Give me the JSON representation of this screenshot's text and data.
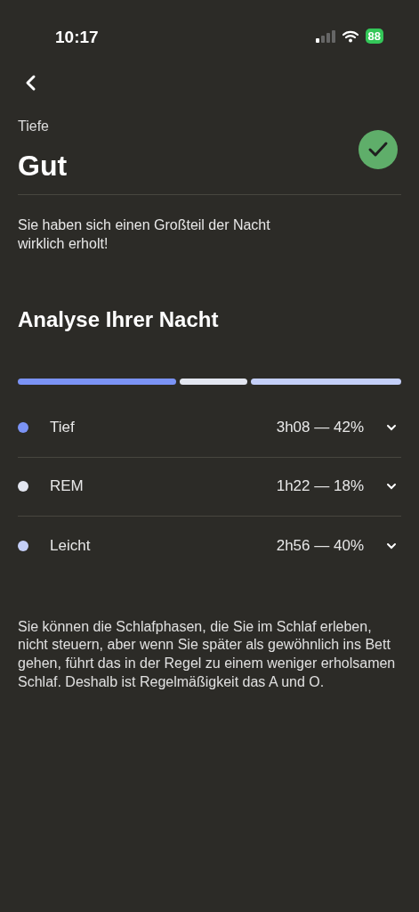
{
  "status_bar": {
    "time": "10:17",
    "battery": "88"
  },
  "header": {
    "label": "Tiefe",
    "title": "Gut",
    "checked": true
  },
  "summary": "Sie haben sich einen Großteil der Nacht wirklich erholt!",
  "analysis": {
    "title": "Analyse Ihrer Nacht",
    "phases": [
      {
        "name": "Tief",
        "value": "3h08 — 42%",
        "color": "#7b93f5",
        "expanded": false
      },
      {
        "name": "REM",
        "value": "1h22 — 18%",
        "color": "#e3e6f0",
        "expanded": false
      },
      {
        "name": "Leicht",
        "value": "2h56 — 40%",
        "color": "#c4cff8",
        "expanded": false
      }
    ]
  },
  "footnote": "Sie können die Schlafphasen, die Sie im Schlaf erleben, nicht steuern, aber wenn Sie später als gewöhnlich ins Bett gehen, führt das in der Regel zu einem weniger erholsamen Schlaf. Deshalb ist Regelmäßigkeit das A und O."
}
